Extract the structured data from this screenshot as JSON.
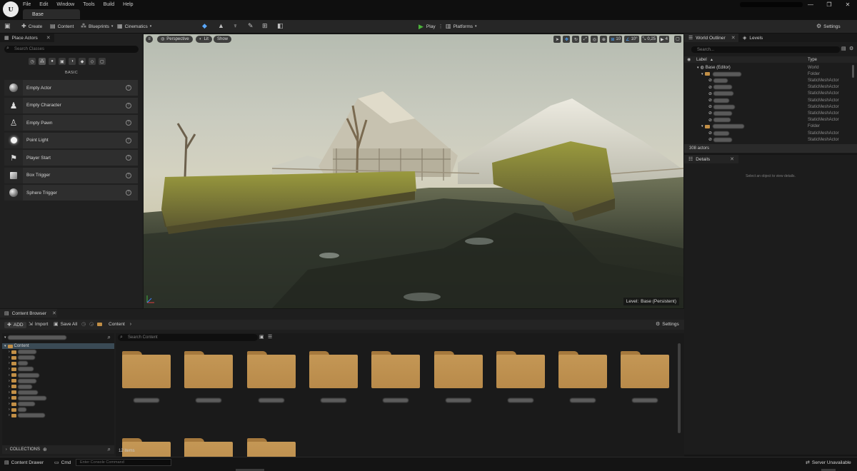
{
  "menu": {
    "items": [
      "File",
      "Edit",
      "Window",
      "Tools",
      "Build",
      "Help"
    ]
  },
  "document_tab": "Base",
  "toolbar": {
    "create": "Create",
    "content": "Content",
    "blueprints": "Blueprints",
    "cinematics": "Cinematics",
    "play": "Play",
    "platforms": "Platforms",
    "settings": "Settings"
  },
  "place_actors": {
    "tab": "Place Actors",
    "search_placeholder": "Search Classes",
    "section": "BASIC",
    "items": [
      {
        "label": "Empty Actor",
        "icon": "sphere-icon"
      },
      {
        "label": "Empty Character",
        "icon": "character-icon"
      },
      {
        "label": "Empty Pawn",
        "icon": "pawn-icon"
      },
      {
        "label": "Point Light",
        "icon": "light-bulb-icon"
      },
      {
        "label": "Player Start",
        "icon": "flag-icon"
      },
      {
        "label": "Box Trigger",
        "icon": "cube-icon"
      },
      {
        "label": "Sphere Trigger",
        "icon": "sphere-icon"
      }
    ]
  },
  "viewport": {
    "perspective": "Perspective",
    "lit": "Lit",
    "show": "Show",
    "grid_size": "10",
    "rotation_snap": "10°",
    "scale_snap": "0,25",
    "camera_speed": "4",
    "level_label": "Level:",
    "level_name": "Base (Persistent)"
  },
  "outliner": {
    "tab": "World Outliner",
    "levels_tab": "Levels",
    "search_placeholder": "Search...",
    "col_label": "Label",
    "col_type": "Type",
    "rows": [
      {
        "label": "Base (Editor)",
        "type": "World"
      },
      {
        "label": "",
        "type": "Folder"
      },
      {
        "label": "",
        "type": "StaticMeshActor"
      },
      {
        "label": "",
        "type": "StaticMeshActor"
      },
      {
        "label": "",
        "type": "StaticMeshActor"
      },
      {
        "label": "",
        "type": "StaticMeshActor"
      },
      {
        "label": "",
        "type": "StaticMeshActor"
      },
      {
        "label": "",
        "type": "StaticMeshActor"
      },
      {
        "label": "",
        "type": "StaticMeshActor"
      },
      {
        "label": "",
        "type": "Folder"
      },
      {
        "label": "",
        "type": "StaticMeshActor"
      },
      {
        "label": "",
        "type": "StaticMeshActor"
      }
    ],
    "count": "308 actors"
  },
  "details": {
    "tab": "Details",
    "empty_message": "Select an object to view details."
  },
  "content_browser": {
    "tab": "Content Browser",
    "add": "ADD",
    "import": "Import",
    "save_all": "Save All",
    "path_root": "Content",
    "settings": "Settings",
    "search_placeholder": "Search Content",
    "tree_root": "Content",
    "collections": "COLLECTIONS",
    "item_count": "12 items",
    "folder_count": 12
  },
  "statusbar": {
    "content_drawer": "Content Drawer",
    "cmd": "Cmd",
    "console_placeholder": "Enter Console Command",
    "server_status": "Server Unavailable"
  },
  "colors": {
    "play_green": "#4bb33a",
    "folder_tan": "#c49755",
    "selection": "#3a4a55"
  }
}
